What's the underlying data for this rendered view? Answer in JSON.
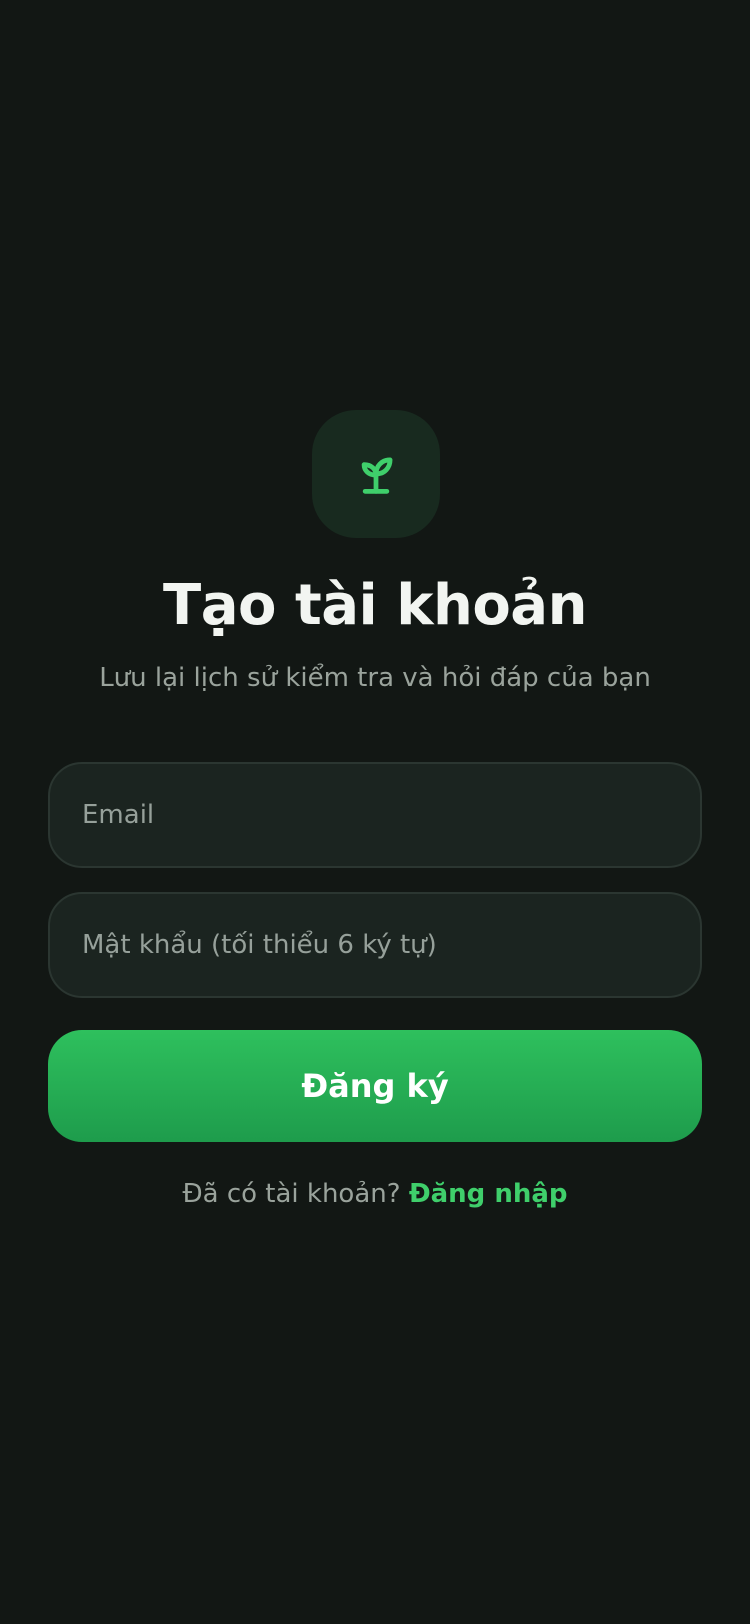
{
  "header": {
    "logo_icon": "sprout-icon",
    "title": "Tạo tài khoản",
    "subtitle": "Lưu lại lịch sử kiểm tra và hỏi đáp của bạn"
  },
  "form": {
    "email_placeholder": "Email",
    "email_value": "",
    "password_placeholder": "Mật khẩu (tối thiểu 6 ký tự)",
    "password_value": "",
    "submit_label": "Đăng ký"
  },
  "footer": {
    "prompt": "Đã có tài khoản? ",
    "login_label": "Đăng nhập"
  },
  "colors": {
    "background": "#121714",
    "accent": "#2ec05d",
    "link": "#3fcf6b"
  }
}
